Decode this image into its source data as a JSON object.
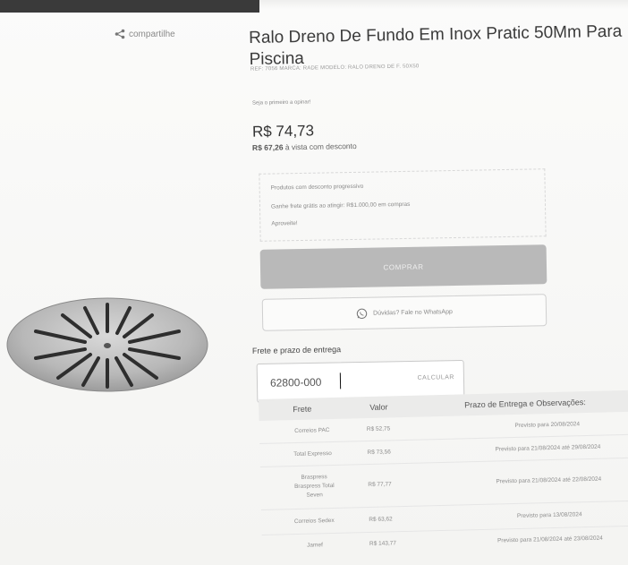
{
  "product": {
    "title": "Ralo Dreno De Fundo Em Inox Pratic 50Mm Para Piscina",
    "meta": "REF: 7056   MARCA: RADE   MODELO: RALO DRENO DE F. 50X50",
    "review_link": "Seja o primeiro a opinar!",
    "price": "R$ 74,73",
    "discount_price": "R$ 67,26",
    "discount_suffix": " à vista com desconto"
  },
  "share": {
    "label": "compartilhe",
    "icon": "share-icon"
  },
  "promo": {
    "line1": "Produtos com desconto progressivo",
    "line2": "Ganhe frete grátis ao atingir: R$1.000,00 em compras",
    "line3": "Aproveite!"
  },
  "buttons": {
    "buy": "COMPRAR",
    "whatsapp": "Dúvidas? Fale no WhatsApp",
    "calc": "CALCULAR"
  },
  "shipping": {
    "label": "Frete e prazo de entrega",
    "cep_value": "62800-000",
    "headers": [
      "Frete",
      "Valor",
      "Prazo de Entrega e Observações:"
    ],
    "rows": [
      {
        "name": "Correios PAC",
        "value": "R$ 52,75",
        "prazo": "Previsto para 20/08/2024"
      },
      {
        "name": "Total Expresso",
        "value": "R$ 73,56",
        "prazo": "Previsto para 21/08/2024 até 29/08/2024"
      },
      {
        "name": "Braspress Braspress Total Seven",
        "value": "R$ 77,77",
        "prazo": "Previsto para 21/08/2024 até 22/08/2024"
      },
      {
        "name": "Correios Sedex",
        "value": "R$ 63,62",
        "prazo": "Previsto para 13/08/2024"
      },
      {
        "name": "Jamef",
        "value": "R$ 143,77",
        "prazo": "Previsto para 21/08/2024 até 23/08/2024"
      }
    ]
  },
  "colors": {
    "buy_button": "#b9b9b9",
    "text": "#333333",
    "table_head": "#ebebea"
  }
}
